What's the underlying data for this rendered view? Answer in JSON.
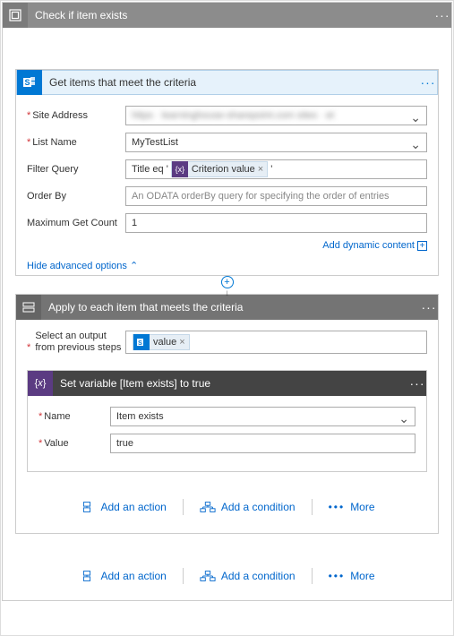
{
  "root": {
    "title": "Check if item exists",
    "menu": "···"
  },
  "getItems": {
    "title": "Get items that meet the criteria",
    "menu": "···",
    "siteAddress": {
      "label": "Site Address",
      "value": "https · learninghouse-sharepoint.com sites · et"
    },
    "listName": {
      "label": "List Name",
      "value": "MyTestList"
    },
    "filterQuery": {
      "label": "Filter Query",
      "prefix": "Title eq '",
      "tokenLabel": "Criterion value",
      "suffix": "'"
    },
    "orderBy": {
      "label": "Order By",
      "placeholder": "An ODATA orderBy query for specifying the order of entries"
    },
    "maxCount": {
      "label": "Maximum Get Count",
      "value": "1"
    },
    "addDynamic": "Add dynamic content",
    "hideAdv": "Hide advanced options"
  },
  "applyEach": {
    "title": "Apply to each item that meets the criteria",
    "menu": "···",
    "selectOutput": {
      "label1": "Select an output",
      "label2": "from previous steps",
      "tokenLabel": "value"
    }
  },
  "setVar": {
    "title": "Set variable [Item exists] to true",
    "menu": "···",
    "name": {
      "label": "Name",
      "value": "Item exists"
    },
    "value": {
      "label": "Value",
      "value": "true"
    }
  },
  "actions": {
    "addAction": "Add an action",
    "addCondition": "Add a condition",
    "more": "More"
  }
}
